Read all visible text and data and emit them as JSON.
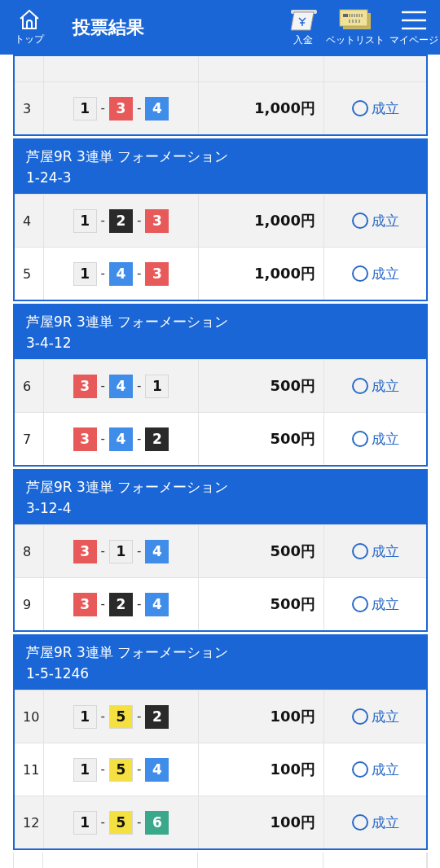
{
  "header": {
    "home_label": "トップ",
    "title": "投票結果",
    "actions": [
      {
        "kind": "deposit",
        "label": "入金"
      },
      {
        "kind": "betlist",
        "label": "ベットリスト"
      },
      {
        "kind": "menu",
        "label": "マイページ"
      }
    ]
  },
  "groups": [
    {
      "rows": [
        {
          "no": "3",
          "horses": [
            {
              "kind": "boat",
              "num": "1",
              "color": "#f0f0f0"
            },
            {
              "kind": "dash",
              "text": "-"
            },
            {
              "kind": "boat",
              "num": "3",
              "color": "#e85a5a"
            },
            {
              "kind": "dash",
              "text": "-"
            },
            {
              "kind": "boat",
              "num": "4",
              "color": "#3f8de8"
            }
          ],
          "amount": "1,000円",
          "status": "成立"
        }
      ]
    },
    {
      "title": "芦屋9R 3連単 フォーメーション",
      "combo": "1-24-3",
      "rows": [
        {
          "no": "4",
          "horses": [
            {
              "kind": "boat",
              "num": "1",
              "color": "#f0f0f0"
            },
            {
              "kind": "dash",
              "text": "-"
            },
            {
              "kind": "boat",
              "num": "2",
              "color": "#2a2a2a"
            },
            {
              "kind": "dash",
              "text": "-"
            },
            {
              "kind": "boat",
              "num": "3",
              "color": "#e85a5a"
            }
          ],
          "amount": "1,000円",
          "status": "成立"
        },
        {
          "no": "5",
          "horses": [
            {
              "kind": "boat",
              "num": "1",
              "color": "#f0f0f0"
            },
            {
              "kind": "dash",
              "text": "-"
            },
            {
              "kind": "boat",
              "num": "4",
              "color": "#3f8de8"
            },
            {
              "kind": "dash",
              "text": "-"
            },
            {
              "kind": "boat",
              "num": "3",
              "color": "#e85a5a"
            }
          ],
          "amount": "1,000円",
          "status": "成立"
        }
      ]
    },
    {
      "title": "芦屋9R 3連単 フォーメーション",
      "combo": "3-4-12",
      "rows": [
        {
          "no": "6",
          "horses": [
            {
              "kind": "boat",
              "num": "3",
              "color": "#e85a5a"
            },
            {
              "kind": "dash",
              "text": "-"
            },
            {
              "kind": "boat",
              "num": "4",
              "color": "#3f8de8"
            },
            {
              "kind": "dash",
              "text": "-"
            },
            {
              "kind": "boat",
              "num": "1",
              "color": "#f0f0f0"
            }
          ],
          "amount": "500円",
          "status": "成立"
        },
        {
          "no": "7",
          "horses": [
            {
              "kind": "boat",
              "num": "3",
              "color": "#e85a5a"
            },
            {
              "kind": "dash",
              "text": "-"
            },
            {
              "kind": "boat",
              "num": "4",
              "color": "#3f8de8"
            },
            {
              "kind": "dash",
              "text": "-"
            },
            {
              "kind": "boat",
              "num": "2",
              "color": "#2a2a2a"
            }
          ],
          "amount": "500円",
          "status": "成立"
        }
      ]
    },
    {
      "title": "芦屋9R 3連単 フォーメーション",
      "combo": "3-12-4",
      "rows": [
        {
          "no": "8",
          "horses": [
            {
              "kind": "boat",
              "num": "3",
              "color": "#e85a5a"
            },
            {
              "kind": "dash",
              "text": "-"
            },
            {
              "kind": "boat",
              "num": "1",
              "color": "#f0f0f0"
            },
            {
              "kind": "dash",
              "text": "-"
            },
            {
              "kind": "boat",
              "num": "4",
              "color": "#3f8de8"
            }
          ],
          "amount": "500円",
          "status": "成立"
        },
        {
          "no": "9",
          "horses": [
            {
              "kind": "boat",
              "num": "3",
              "color": "#e85a5a"
            },
            {
              "kind": "dash",
              "text": "-"
            },
            {
              "kind": "boat",
              "num": "2",
              "color": "#2a2a2a"
            },
            {
              "kind": "dash",
              "text": "-"
            },
            {
              "kind": "boat",
              "num": "4",
              "color": "#3f8de8"
            }
          ],
          "amount": "500円",
          "status": "成立"
        }
      ]
    },
    {
      "title": "芦屋9R 3連単 フォーメーション",
      "combo": "1-5-1246",
      "rows": [
        {
          "no": "10",
          "horses": [
            {
              "kind": "boat",
              "num": "1",
              "color": "#f0f0f0"
            },
            {
              "kind": "dash",
              "text": "-"
            },
            {
              "kind": "boat",
              "num": "5",
              "color": "#f5e042"
            },
            {
              "kind": "dash",
              "text": "-"
            },
            {
              "kind": "boat",
              "num": "2",
              "color": "#2a2a2a"
            }
          ],
          "amount": "100円",
          "status": "成立"
        },
        {
          "no": "11",
          "horses": [
            {
              "kind": "boat",
              "num": "1",
              "color": "#f0f0f0"
            },
            {
              "kind": "dash",
              "text": "-"
            },
            {
              "kind": "boat",
              "num": "5",
              "color": "#f5e042"
            },
            {
              "kind": "dash",
              "text": "-"
            },
            {
              "kind": "boat",
              "num": "4",
              "color": "#3f8de8"
            }
          ],
          "amount": "100円",
          "status": "成立"
        },
        {
          "no": "12",
          "horses": [
            {
              "kind": "boat",
              "num": "1",
              "color": "#f0f0f0"
            },
            {
              "kind": "dash",
              "text": "-"
            },
            {
              "kind": "boat",
              "num": "5",
              "color": "#f5e042"
            },
            {
              "kind": "dash",
              "text": "-"
            },
            {
              "kind": "boat",
              "num": "6",
              "color": "#3aa88a"
            }
          ],
          "amount": "100円",
          "status": "成立"
        }
      ]
    }
  ]
}
